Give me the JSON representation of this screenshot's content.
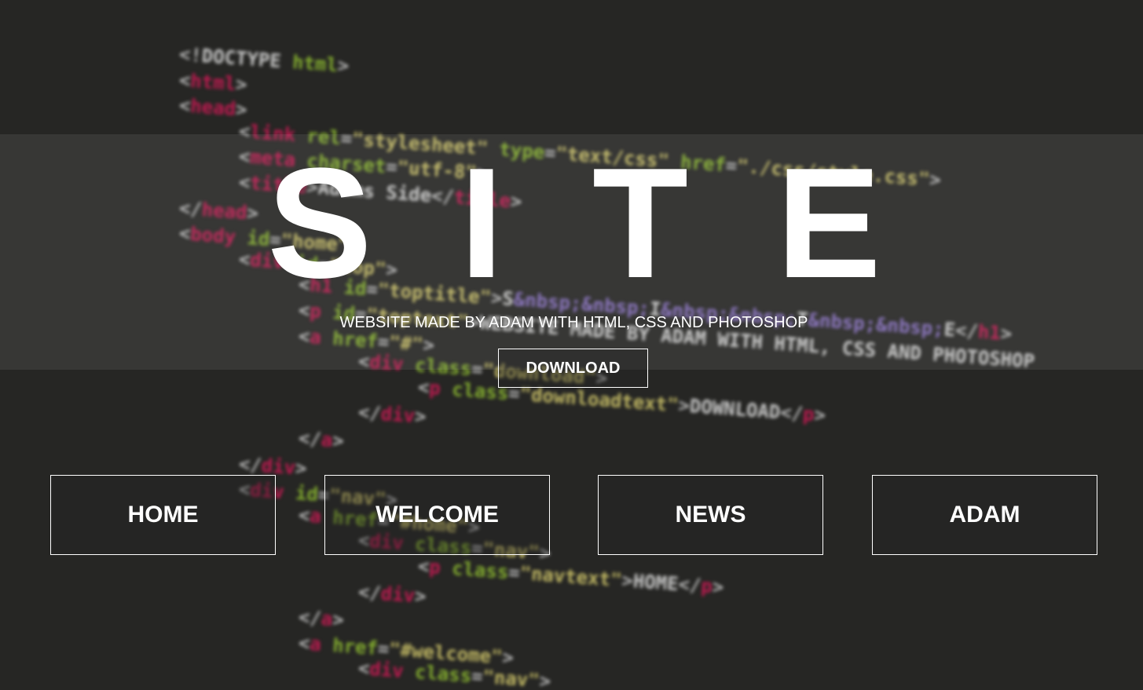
{
  "hero": {
    "title_letters": [
      "S",
      "I",
      "T",
      "E"
    ],
    "subtitle": "WEBSITE MADE BY ADAM WITH HTML, CSS AND PHOTOSHOP",
    "download_label": "DOWNLOAD"
  },
  "nav": {
    "items": [
      {
        "label": "HOME"
      },
      {
        "label": "WELCOME"
      },
      {
        "label": "NEWS"
      },
      {
        "label": "ADAM"
      }
    ]
  },
  "background_code": {
    "lines": [
      "<!DOCTYPE html>",
      "<html>",
      "<head>",
      "<link rel=\"stylesheet\" type=\"text/css\" href=\"./css/style.css\">",
      "<meta charset=\"utf-8\">",
      "<title>Adams Side</title>",
      "</head>",
      "<body id=\"home\">",
      "<div id=\"top\">",
      "<h1 id=\"toptitle\">S&nbsp;&nbsp;I&nbsp;&nbsp;T&nbsp;&nbsp;E</h1>",
      "<p id=\"toptext\">WEBSITE MADE BY ADAM WITH HTML, CSS AND PHOTOSHOP",
      "<a href=\"#\">",
      "<div class=\"download\">",
      "<p class=\"downloadtext\">DOWNLOAD</p>",
      "</div>",
      "</a>",
      "</div>",
      "<div id=\"nav\">",
      "<a href=\"#home\">",
      "<div class=\"nav\">",
      "<p class=\"navtext\">HOME</p>",
      "</div>",
      "</a>",
      "<a href=\"#welcome\">",
      "<div class=\"nav\">"
    ]
  },
  "colors": {
    "background": "#262624",
    "text": "#ffffff",
    "code_tag": "#e0185a",
    "code_attr": "#9acd32",
    "code_string": "#e6db74",
    "code_entity": "#9b7fe0"
  }
}
